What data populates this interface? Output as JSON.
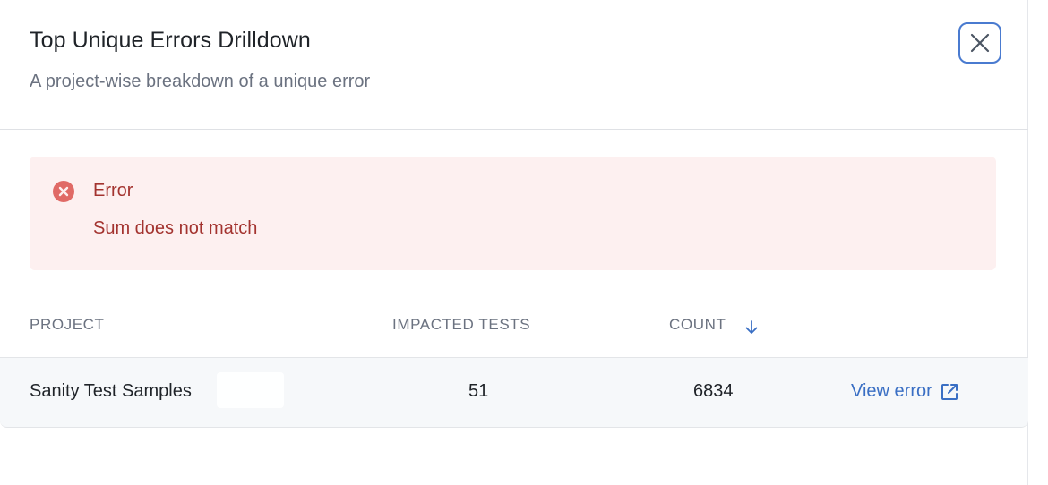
{
  "dialog": {
    "title": "Top Unique Errors Drilldown",
    "subtitle": "A project-wise breakdown of a unique error",
    "close_icon": "close-icon"
  },
  "alert": {
    "icon": "error-circle-icon",
    "title": "Error",
    "message": "Sum does not match",
    "color": "#a3332f",
    "background": "#fdf0f0"
  },
  "table": {
    "headers": {
      "project": "PROJECT",
      "impacted_tests": "IMPACTED TESTS",
      "count": "COUNT"
    },
    "sort": {
      "column": "count",
      "direction": "descending",
      "icon": "arrow-down-icon"
    },
    "rows": [
      {
        "project": "Sanity Test Samples",
        "impacted_tests": "51",
        "count": "6834",
        "action": "View error",
        "action_icon": "external-link-icon"
      }
    ]
  },
  "colors": {
    "accent": "#3a6fc4",
    "close_border": "#4a7bd0"
  }
}
